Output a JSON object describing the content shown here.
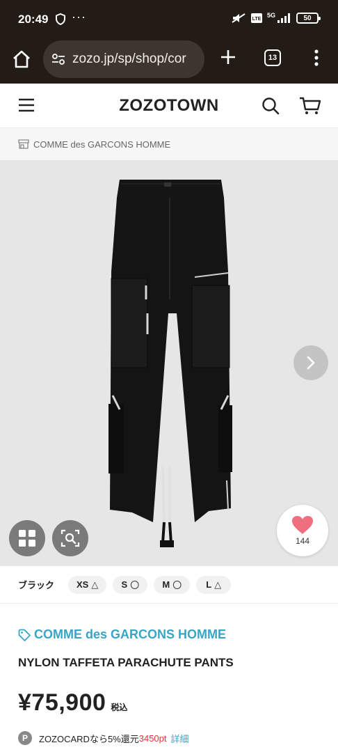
{
  "status_bar": {
    "time": "20:49",
    "dots": "···",
    "network": "5G",
    "battery": "50",
    "icons": [
      "shield-icon",
      "mute-icon",
      "volte-icon",
      "signal-icon",
      "battery-icon"
    ]
  },
  "browser": {
    "url": "zozo.jp/sp/shop/cor",
    "tab_count": "13",
    "icons": [
      "home-icon",
      "site-settings-icon",
      "plus-icon",
      "tabs-icon",
      "more-icon"
    ]
  },
  "header": {
    "logo": "ZOZOTOWN",
    "icons": [
      "hamburger-menu-icon",
      "search-icon",
      "cart-icon"
    ]
  },
  "breadcrumb": {
    "shop_name": "COMME des GARCONS HOMME"
  },
  "gallery": {
    "like_count": "144",
    "colors": {
      "background": "#e6e6e6",
      "like_heart": "#ef6f7f"
    },
    "icons": [
      "chevron-right-icon",
      "grid-icon",
      "image-search-icon",
      "heart-icon"
    ]
  },
  "sizes": {
    "color_label": "ブラック",
    "chips": [
      {
        "size": "XS",
        "stock": "△"
      },
      {
        "size": "S",
        "stock": "〇"
      },
      {
        "size": "M",
        "stock": "〇"
      },
      {
        "size": "L",
        "stock": "△"
      }
    ]
  },
  "product": {
    "brand": "COMME des GARCONS HOMME",
    "name": "NYLON TAFFETA PARACHUTE PANTS",
    "price": "¥75,900",
    "tax_label": "税込",
    "card_badge": "P",
    "card_text": "ZOZOCARDなら5%還元",
    "card_points": "3450pt",
    "card_detail": "詳細",
    "colors": {
      "brand": "#38a4c6",
      "points": "#e0333a"
    }
  }
}
